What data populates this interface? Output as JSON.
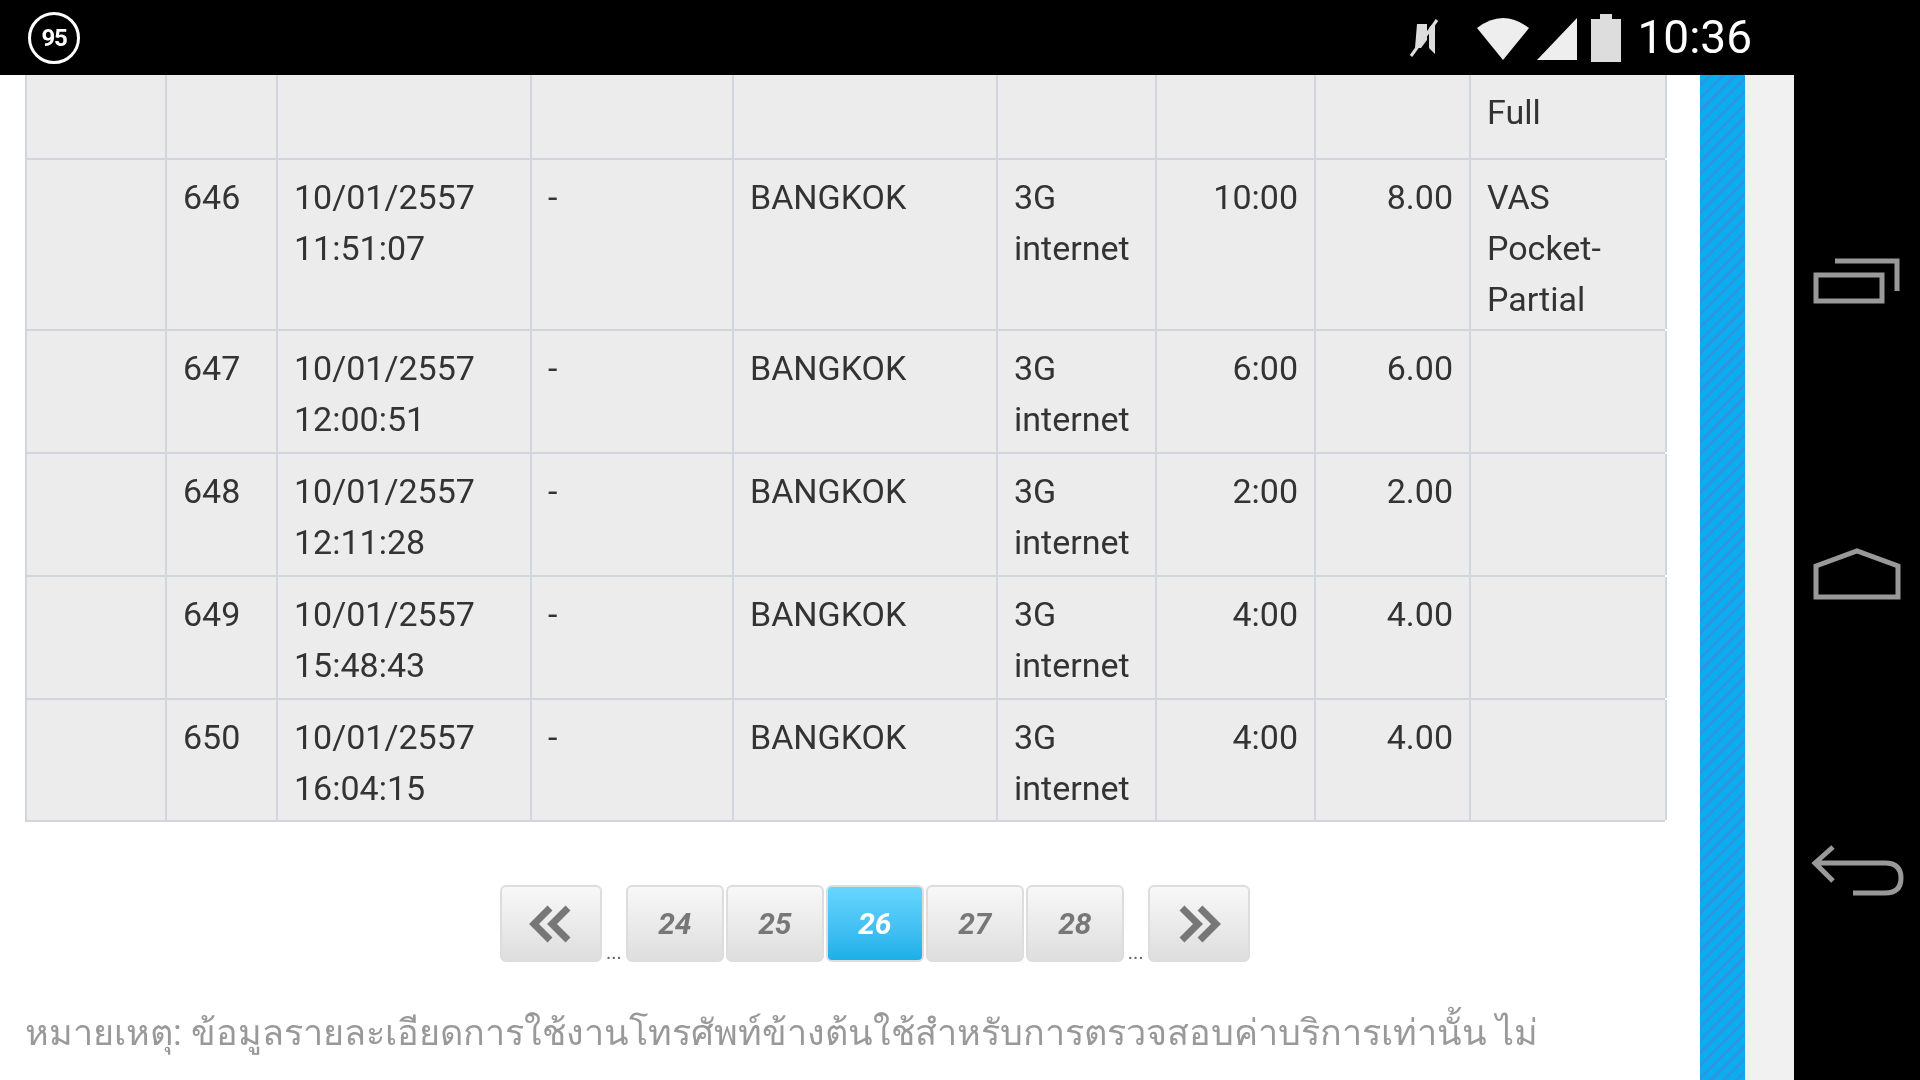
{
  "status_bar": {
    "notification_badge": "95",
    "time": "10:36"
  },
  "table": {
    "rows": [
      {
        "cells": [
          "",
          "",
          "",
          "",
          "",
          "",
          "",
          "",
          "Full"
        ]
      },
      {
        "cells": [
          "",
          "646",
          "10/01/2557\n11:51:07",
          "-",
          "BANGKOK",
          "3G\ninternet",
          "10:00",
          "8.00",
          "VAS\nPocket-\nPartial"
        ]
      },
      {
        "cells": [
          "",
          "647",
          "10/01/2557\n12:00:51",
          "-",
          "BANGKOK",
          "3G\ninternet",
          "6:00",
          "6.00",
          ""
        ]
      },
      {
        "cells": [
          "",
          "648",
          "10/01/2557\n12:11:28",
          "-",
          "BANGKOK",
          "3G\ninternet",
          "2:00",
          "2.00",
          ""
        ]
      },
      {
        "cells": [
          "",
          "649",
          "10/01/2557\n15:48:43",
          "-",
          "BANGKOK",
          "3G\ninternet",
          "4:00",
          "4.00",
          ""
        ]
      },
      {
        "cells": [
          "",
          "650",
          "10/01/2557\n16:04:15",
          "-",
          "BANGKOK",
          "3G\ninternet",
          "4:00",
          "4.00",
          ""
        ]
      }
    ]
  },
  "pagination": {
    "pages": [
      {
        "label": "24",
        "selected": false
      },
      {
        "label": "25",
        "selected": false
      },
      {
        "label": "26",
        "selected": true
      },
      {
        "label": "27",
        "selected": false
      },
      {
        "label": "28",
        "selected": false
      }
    ],
    "ellipsis_before": "...",
    "ellipsis_after": "..."
  },
  "note": "หมายเหตุ: ข้อมูลรายละเอียดการใช้งานโทรศัพท์ข้างต้นใช้สำหรับการตรวจสอบค่าบริการเท่านั้น ไม่"
}
